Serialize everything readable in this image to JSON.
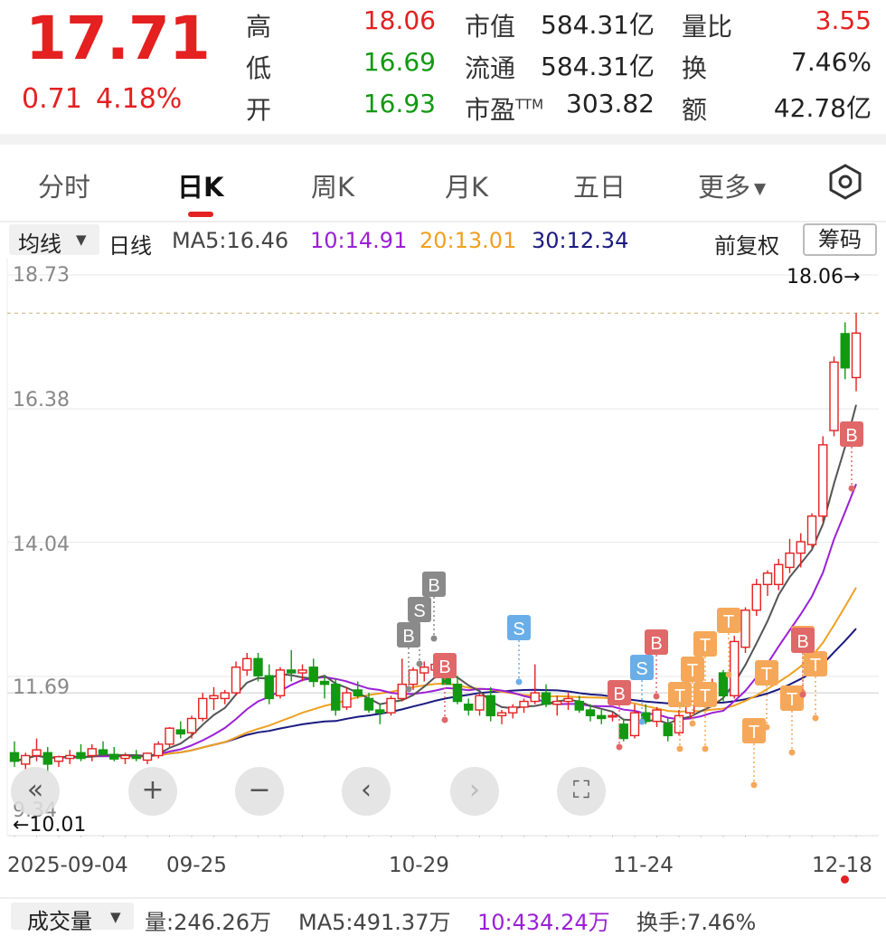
{
  "quote": {
    "price": "17.71",
    "change": "0.71",
    "change_pct": "4.18%",
    "stats": [
      {
        "label": "高",
        "value": "18.06",
        "color": "#e42020"
      },
      {
        "label": "低",
        "value": "16.69",
        "color": "#119911"
      },
      {
        "label": "开",
        "value": "16.93",
        "color": "#119911"
      },
      {
        "label": "市值",
        "value": "584.31亿"
      },
      {
        "label": "流通",
        "value": "584.31亿"
      },
      {
        "label": "市盈",
        "label_sup": "TTM",
        "value": "303.82"
      },
      {
        "label": "量比",
        "value": "3.55",
        "color": "#e42020"
      },
      {
        "label": "换",
        "value": "7.46%"
      },
      {
        "label": "额",
        "value": "42.78亿"
      }
    ]
  },
  "tabs": [
    "分时",
    "日K",
    "周K",
    "月K",
    "五日",
    "更多"
  ],
  "active_tab": "日K",
  "ma_bar": {
    "selector": "均线",
    "type": "日线",
    "ma5": "MA5:16.46",
    "ma10": "10:14.91",
    "ma20": "20:13.01",
    "ma30": "30:12.34",
    "adjust": "前复权",
    "chips": "筹码"
  },
  "chart": {
    "y_labels": [
      "18.73",
      "16.38",
      "14.04",
      "11.69",
      "9.34"
    ],
    "high_marker": "18.06→",
    "low_marker": "←10.01",
    "x_labels": [
      "2025-09-04",
      "09-25",
      "10-29",
      "11-24",
      "12-18"
    ],
    "colors": {
      "up": "#e42020",
      "down": "#119911",
      "ma5": "#555555",
      "ma10": "#9b20d6",
      "ma20": "#f0a020",
      "ma30": "#1a1a80"
    },
    "signals": [
      "B",
      "S",
      "B",
      "B",
      "S",
      "B",
      "S",
      "B",
      "T",
      "T",
      "T",
      "T",
      "T",
      "T",
      "T",
      "T",
      "T",
      "T",
      "B",
      "B"
    ]
  },
  "controls": {
    "collapse": "«",
    "zoom_in": "+",
    "zoom_out": "−",
    "prev": "‹",
    "next": "›",
    "fullscreen": "⛶"
  },
  "volume": {
    "selector": "成交量",
    "vol": "量:246.26万",
    "ma5": "MA5:491.37万",
    "ma10": "10:434.24万",
    "turnover": "换手:7.46%"
  },
  "chart_data": {
    "type": "candlestick",
    "ylim": [
      9.34,
      18.73
    ],
    "ohlc": [
      [
        10.35,
        10.55,
        10.1,
        10.2
      ],
      [
        10.15,
        10.35,
        10.05,
        10.3
      ],
      [
        10.3,
        10.6,
        10.2,
        10.4
      ],
      [
        10.35,
        10.45,
        10.01,
        10.15
      ],
      [
        10.2,
        10.3,
        10.1,
        10.28
      ],
      [
        10.25,
        10.4,
        10.15,
        10.3
      ],
      [
        10.35,
        10.5,
        10.2,
        10.25
      ],
      [
        10.3,
        10.5,
        10.2,
        10.42
      ],
      [
        10.4,
        10.55,
        10.3,
        10.33
      ],
      [
        10.32,
        10.45,
        10.2,
        10.24
      ],
      [
        10.25,
        10.35,
        10.15,
        10.3
      ],
      [
        10.28,
        10.4,
        10.2,
        10.25
      ],
      [
        10.22,
        10.35,
        10.15,
        10.34
      ],
      [
        10.3,
        10.55,
        10.25,
        10.5
      ],
      [
        10.5,
        10.8,
        10.45,
        10.78
      ],
      [
        10.75,
        10.9,
        10.6,
        10.68
      ],
      [
        10.7,
        11.0,
        10.6,
        10.95
      ],
      [
        10.95,
        11.4,
        10.9,
        11.3
      ],
      [
        11.3,
        11.5,
        11.1,
        11.35
      ],
      [
        11.3,
        11.45,
        11.2,
        11.4
      ],
      [
        11.4,
        11.95,
        11.35,
        11.85
      ],
      [
        11.8,
        12.1,
        11.7,
        12.0
      ],
      [
        12.0,
        12.1,
        11.6,
        11.7
      ],
      [
        11.7,
        11.9,
        11.2,
        11.3
      ],
      [
        11.35,
        11.85,
        11.3,
        11.8
      ],
      [
        11.8,
        12.15,
        11.6,
        11.75
      ],
      [
        11.75,
        11.9,
        11.6,
        11.8
      ],
      [
        11.85,
        12.0,
        11.5,
        11.6
      ],
      [
        11.6,
        11.7,
        11.3,
        11.55
      ],
      [
        11.55,
        11.65,
        11.0,
        11.1
      ],
      [
        11.15,
        11.5,
        11.1,
        11.4
      ],
      [
        11.45,
        11.6,
        11.3,
        11.35
      ],
      [
        11.3,
        11.4,
        11.05,
        11.1
      ],
      [
        11.1,
        11.2,
        10.85,
        11.05
      ],
      [
        11.05,
        11.35,
        11.0,
        11.3
      ],
      [
        11.3,
        12.0,
        11.25,
        11.55
      ],
      [
        11.55,
        11.85,
        11.45,
        11.8
      ],
      [
        11.75,
        11.95,
        11.6,
        11.85
      ],
      [
        11.8,
        11.95,
        11.65,
        11.9
      ],
      [
        11.9,
        12.1,
        11.7,
        11.55
      ],
      [
        11.55,
        11.7,
        11.2,
        11.25
      ],
      [
        11.2,
        11.3,
        11.0,
        11.1
      ],
      [
        11.1,
        11.4,
        11.0,
        11.35
      ],
      [
        11.35,
        11.5,
        10.9,
        11.0
      ],
      [
        11.0,
        11.1,
        10.85,
        11.05
      ],
      [
        11.05,
        11.2,
        10.95,
        11.15
      ],
      [
        11.15,
        11.3,
        11.05,
        11.25
      ],
      [
        11.25,
        11.9,
        11.2,
        11.4
      ],
      [
        11.4,
        11.55,
        11.15,
        11.2
      ],
      [
        11.2,
        11.35,
        11.0,
        11.25
      ],
      [
        11.25,
        11.4,
        11.1,
        11.3
      ],
      [
        11.25,
        11.35,
        11.05,
        11.1
      ],
      [
        11.1,
        11.2,
        10.9,
        11.0
      ],
      [
        11.0,
        11.1,
        10.85,
        10.95
      ],
      [
        10.98,
        11.05,
        10.9,
        11.0
      ],
      [
        10.85,
        10.95,
        10.55,
        10.6
      ],
      [
        10.65,
        11.2,
        10.6,
        11.05
      ],
      [
        11.05,
        11.2,
        10.85,
        10.9
      ],
      [
        10.9,
        11.15,
        10.8,
        11.1
      ],
      [
        10.85,
        10.95,
        10.55,
        10.65
      ],
      [
        10.7,
        11.1,
        10.65,
        11.0
      ],
      [
        11.05,
        11.3,
        10.95,
        11.25
      ],
      [
        11.25,
        11.45,
        11.15,
        11.4
      ],
      [
        11.4,
        11.65,
        11.3,
        11.55
      ],
      [
        11.75,
        11.8,
        11.25,
        11.35
      ],
      [
        11.35,
        12.4,
        11.3,
        12.3
      ],
      [
        12.2,
        12.9,
        12.1,
        12.85
      ],
      [
        12.85,
        13.4,
        12.75,
        13.3
      ],
      [
        13.3,
        13.55,
        13.1,
        13.5
      ],
      [
        13.3,
        13.75,
        13.2,
        13.65
      ],
      [
        13.6,
        14.1,
        13.5,
        13.85
      ],
      [
        13.85,
        14.2,
        13.6,
        14.05
      ],
      [
        14.0,
        14.55,
        13.95,
        14.5
      ],
      [
        14.5,
        15.9,
        14.4,
        15.75
      ],
      [
        16.0,
        17.3,
        15.9,
        17.2
      ],
      [
        17.7,
        17.9,
        16.9,
        17.1
      ],
      [
        16.93,
        18.06,
        16.69,
        17.71
      ]
    ],
    "ma_last": {
      "MA5": 16.46,
      "MA10": 14.91,
      "MA20": 13.01,
      "MA30": 12.34
    }
  }
}
